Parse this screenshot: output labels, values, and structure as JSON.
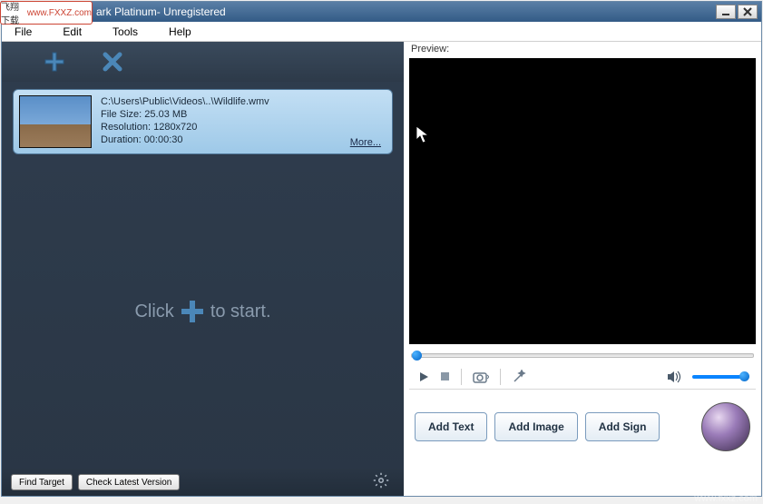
{
  "overlay": {
    "cn": "飞翔下载",
    "url": "www.FXXZ.com"
  },
  "title": "ark Platinum- Unregistered",
  "menu": {
    "file": "File",
    "edit": "Edit",
    "tools": "Tools",
    "help": "Help"
  },
  "file": {
    "path": "C:\\Users\\Public\\Videos\\..\\Wildlife.wmv",
    "size_label": "File Size: 25.03 MB",
    "resolution_label": "Resolution: 1280x720",
    "duration_label": "Duration: 00:00:30",
    "more": "More..."
  },
  "hint": {
    "click": "Click",
    "to_start": "to start."
  },
  "buttons": {
    "find_target": "Find Target",
    "check_version": "Check Latest Version",
    "add_text": "Add Text",
    "add_image": "Add Image",
    "add_sign": "Add Sign"
  },
  "preview_label": "Preview:",
  "watermark": {
    "cn": "飞翔下载",
    "url": "www.fxxz.com"
  }
}
